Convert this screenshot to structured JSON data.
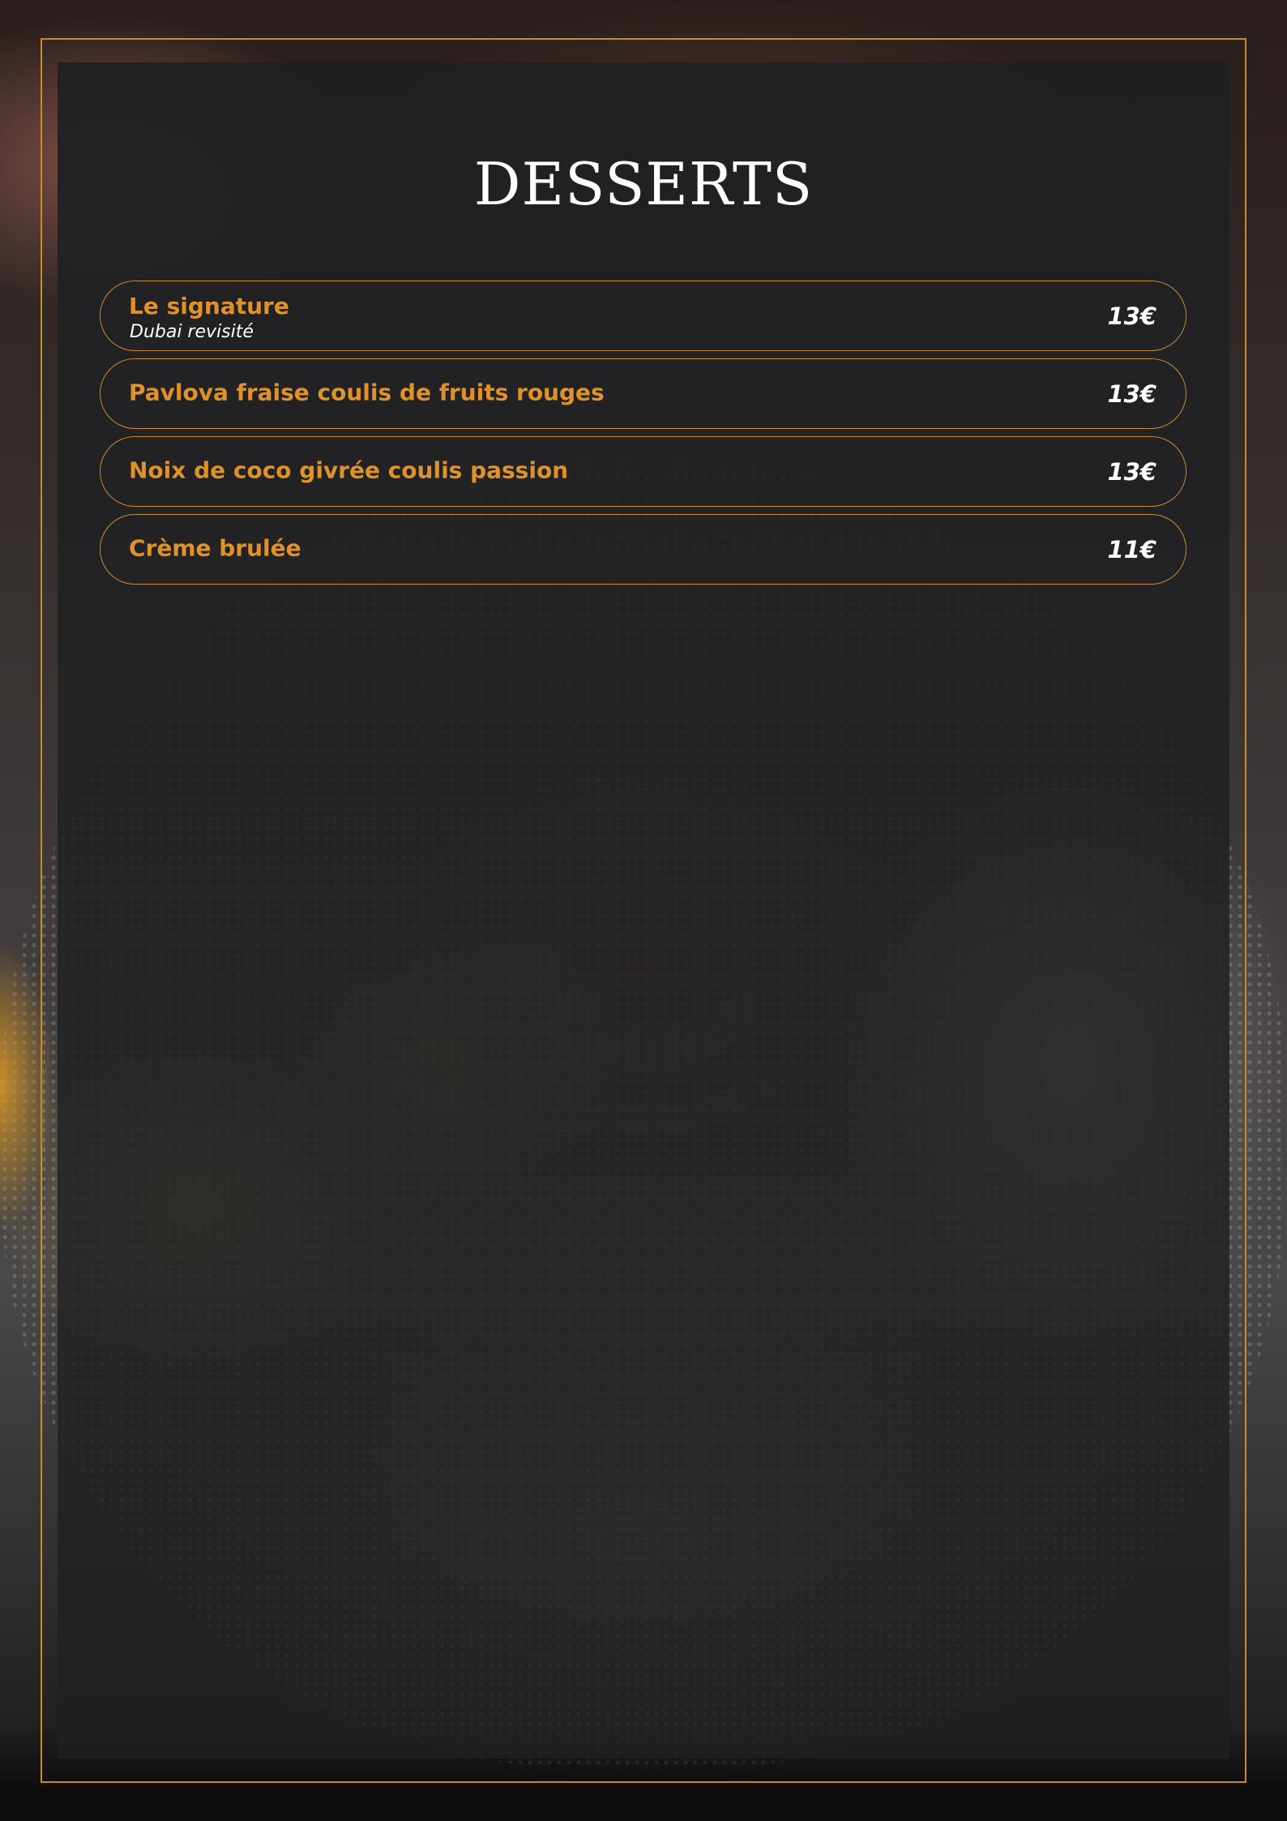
{
  "menu": {
    "title": "DESSERTS",
    "items": [
      {
        "name": "Le signature",
        "subtitle": "Dubai revisité",
        "price": "13€"
      },
      {
        "name": "Pavlova fraise coulis de fruits rouges",
        "price": "13€"
      },
      {
        "name": "Noix de coco givrée coulis passion",
        "price": "13€"
      },
      {
        "name": "Crème brulée",
        "price": "11€"
      }
    ]
  },
  "colors": {
    "accent_gold": "#c98a2a",
    "item_name": "#e0922a",
    "text_white": "#ffffff",
    "panel": "#202124"
  }
}
